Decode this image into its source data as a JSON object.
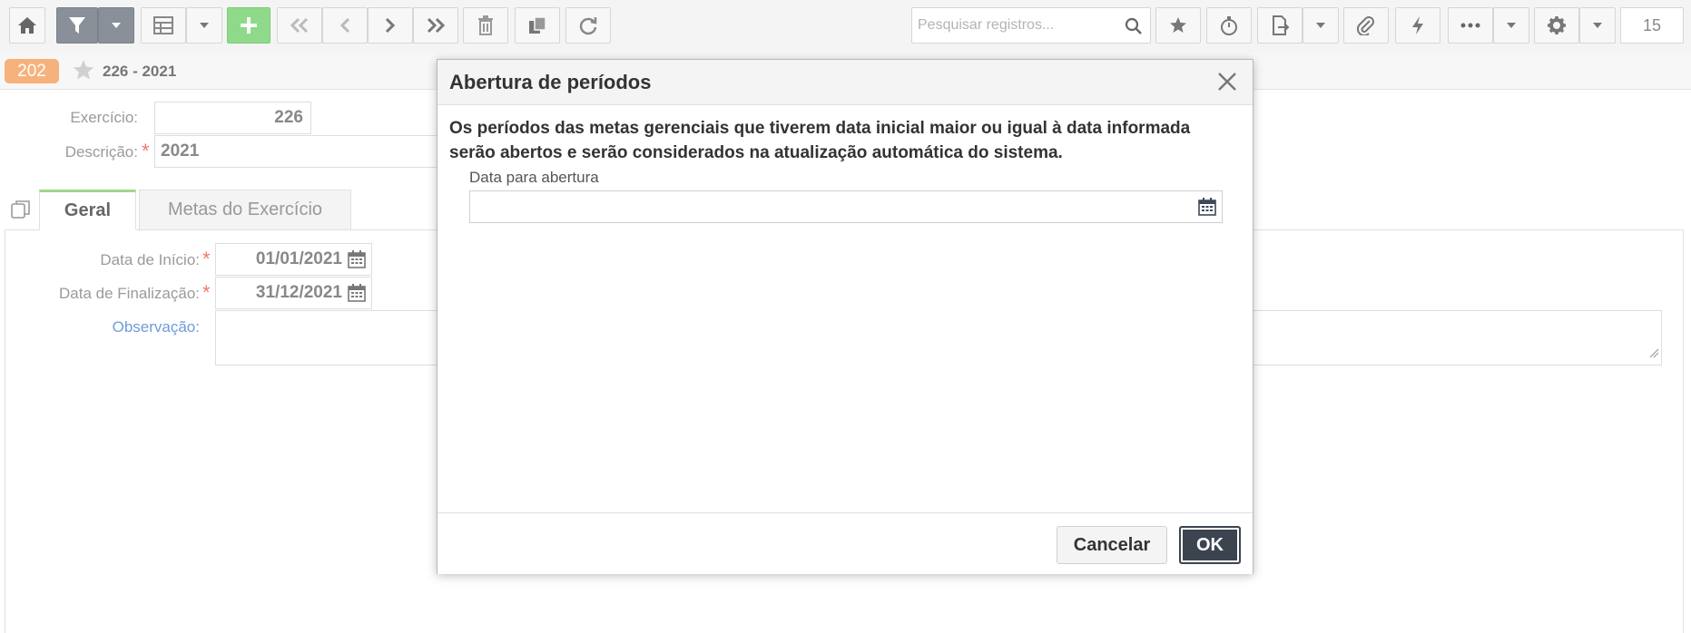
{
  "toolbar": {
    "search_placeholder": "Pesquisar registros...",
    "record_counter": "15"
  },
  "breadcrumb": {
    "badge": "202",
    "title": "226 - 2021"
  },
  "form": {
    "exercicio_label": "Exercício:",
    "exercicio_value": "226",
    "descricao_label": "Descrição:",
    "descricao_value": "2021",
    "tabs": [
      {
        "label": "Geral"
      },
      {
        "label": "Metas do Exercício"
      }
    ],
    "data_inicio_label": "Data de Início:",
    "data_inicio_value": "01/01/2021",
    "data_fim_label": "Data de Finalização:",
    "data_fim_value": "31/12/2021",
    "observacao_label": "Observação:"
  },
  "modal": {
    "title": "Abertura de períodos",
    "message_line1": "Os períodos das metas gerenciais que tiverem data inicial maior ou igual à data informada",
    "message_line2": "serão abertos e serão considerados na atualização automática do sistema.",
    "date_label": "Data para abertura",
    "date_value": "",
    "cancel_label": "Cancelar",
    "ok_label": "OK"
  },
  "colors": {
    "badge": "#f6b27c",
    "active_tab_accent": "#9fd88a",
    "new_button": "#8fd98a",
    "required_star": "#f07a6a",
    "ok_button": "#3c4450",
    "observacao_label": "#6f9bd8"
  }
}
